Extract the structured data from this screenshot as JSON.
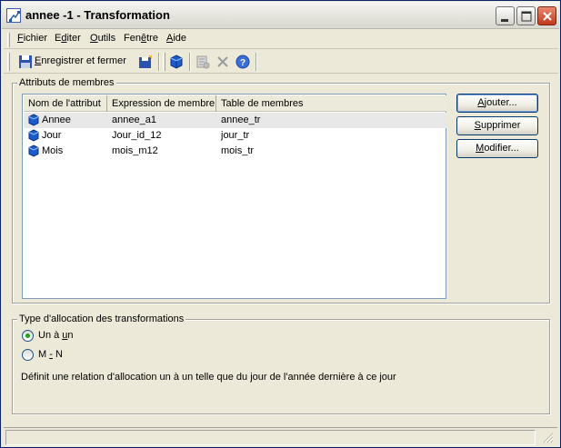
{
  "window": {
    "title": "annee -1 - Transformation"
  },
  "menubar": {
    "items": [
      {
        "label_pre": "",
        "label_ul": "F",
        "label_post": "ichier"
      },
      {
        "label_pre": "E",
        "label_ul": "d",
        "label_post": "iter"
      },
      {
        "label_pre": "",
        "label_ul": "O",
        "label_post": "utils"
      },
      {
        "label_pre": "Fen",
        "label_ul": "ê",
        "label_post": "tre"
      },
      {
        "label_pre": "",
        "label_ul": "A",
        "label_post": "ide"
      }
    ]
  },
  "toolbar": {
    "save_close_pre": "",
    "save_close_ul": "E",
    "save_close_post": "nregistrer et fermer",
    "icons": [
      "save-icon",
      "export-icon",
      "cube-icon",
      "properties-icon",
      "delete-icon",
      "help-icon"
    ]
  },
  "attributes_group": {
    "title": "Attributs de membres",
    "columns": [
      "Nom de l'attribut",
      "Expression de membre",
      "Table de membres"
    ],
    "rows": [
      {
        "name": "Annee",
        "expression": "annee_a1",
        "table": "annee_tr",
        "selected": true
      },
      {
        "name": "Jour",
        "expression": "Jour_id_12",
        "table": "jour_tr",
        "selected": false
      },
      {
        "name": "Mois",
        "expression": "mois_m12",
        "table": "mois_tr",
        "selected": false
      }
    ],
    "buttons": {
      "add": {
        "pre": "",
        "ul": "A",
        "post": "jouter..."
      },
      "remove": {
        "pre": "",
        "ul": "S",
        "post": "upprimer"
      },
      "modify": {
        "pre": "",
        "ul": "M",
        "post": "odifier..."
      }
    }
  },
  "allocation_group": {
    "title": "Type d'allocation des transformations",
    "options": [
      {
        "pre": "Un à ",
        "ul": "u",
        "post": "n",
        "checked": true
      },
      {
        "pre": "M ",
        "ul": "-",
        "post": " N",
        "checked": false
      }
    ],
    "description": "Définit une relation d'allocation un à un telle que du jour de l'année dernière à ce jour"
  },
  "colors": {
    "window_bg": "#ece9d8",
    "close_button": "#c0391b",
    "cube_blue": "#1a5ccc"
  }
}
